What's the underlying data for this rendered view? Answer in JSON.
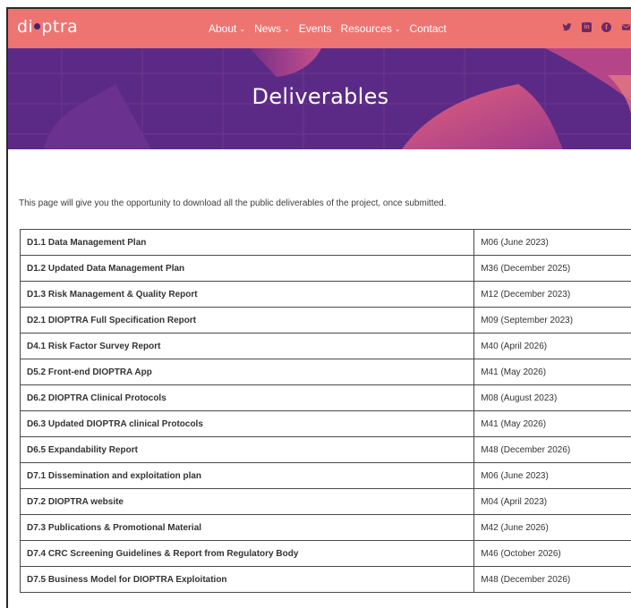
{
  "brand": {
    "logo_text_a": "di",
    "logo_text_b": "ptra"
  },
  "nav": {
    "items": [
      {
        "label": "About",
        "dropdown": true
      },
      {
        "label": "News",
        "dropdown": true
      },
      {
        "label": "Events",
        "dropdown": false
      },
      {
        "label": "Resources",
        "dropdown": true
      },
      {
        "label": "Contact",
        "dropdown": false
      }
    ],
    "social_icons": [
      "twitter-icon",
      "linkedin-icon",
      "facebook-icon",
      "email-icon"
    ]
  },
  "hero": {
    "title": "Deliverables"
  },
  "intro": "This page will give you the opportunity to download all the public deliverables of the project, once submitted.",
  "deliverables": [
    {
      "name": "D1.1 Data Management Plan",
      "date": "M06 (June 2023)"
    },
    {
      "name": "D1.2 Updated Data Management Plan",
      "date": "M36 (December 2025)"
    },
    {
      "name": "D1.3 Risk Management & Quality Report",
      "date": "M12 (December 2023)"
    },
    {
      "name": "D2.1 DIOPTRA Full Specification Report",
      "date": "M09 (September 2023)"
    },
    {
      "name": "D4.1 Risk Factor Survey Report",
      "date": "M40 (April 2026)"
    },
    {
      "name": "D5.2 Front-end DIOPTRA App",
      "date": "M41 (May 2026)"
    },
    {
      "name": "D6.2 DIOPTRA Clinical Protocols",
      "date": "M08 (August 2023)"
    },
    {
      "name": "D6.3 Updated DIOPTRA clinical Protocols",
      "date": "M41 (May 2026)"
    },
    {
      "name": "D6.5 Expandability Report",
      "date": "M48 (December 2026)"
    },
    {
      "name": "D7.1 Dissemination and exploitation plan",
      "date": "M06 (June 2023)"
    },
    {
      "name": "D7.2 DIOPTRA website",
      "date": "M04 (April 2023)"
    },
    {
      "name": "D7.3 Publications & Promotional Material",
      "date": "M42 (June 2026)"
    },
    {
      "name": "D7.4 CRC Screening Guidelines & Report from Regulatory Body",
      "date": "M46 (October 2026)"
    },
    {
      "name": "D7.5 Business Model for DIOPTRA Exploitation",
      "date": "M48 (December 2026)"
    }
  ],
  "colors": {
    "nav_bg": "#ee7471",
    "hero_bg": "#5b2a86",
    "accent": "#ee7471"
  }
}
